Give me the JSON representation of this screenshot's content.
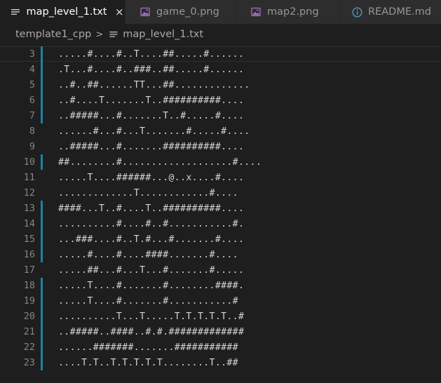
{
  "tabs": [
    {
      "label": "map_level_1.txt",
      "icon": "text-file-icon",
      "active": true,
      "close": "×"
    },
    {
      "label": "game_0.png",
      "icon": "image-file-icon",
      "active": false
    },
    {
      "label": "map2.png",
      "icon": "image-file-icon",
      "active": false
    },
    {
      "label": "README.md",
      "icon": "info-icon",
      "active": false
    }
  ],
  "breadcrumb": {
    "folder": "template1_cpp",
    "separator": ">",
    "file": "map_level_1.txt"
  },
  "editor": {
    "lines": [
      {
        "num": "3",
        "text": ".....#....#..T....##.....#......",
        "modified": true
      },
      {
        "num": "4",
        "text": ".T...#....#..###..##.....#......",
        "modified": true
      },
      {
        "num": "5",
        "text": "..#..##......TT...##.............",
        "modified": true
      },
      {
        "num": "6",
        "text": "..#....T.......T..##########....",
        "modified": true
      },
      {
        "num": "7",
        "text": "..#####...#.......T..#.....#....",
        "modified": true
      },
      {
        "num": "8",
        "text": "......#...#...T.......#.....#....",
        "modified": false
      },
      {
        "num": "9",
        "text": "..#####...#.......##########....",
        "modified": false
      },
      {
        "num": "10",
        "text": "##........#...................#....",
        "modified": true
      },
      {
        "num": "11",
        "text": ".....T....######...@..x....#....",
        "modified": false
      },
      {
        "num": "12",
        "text": ".............T............#....",
        "modified": false
      },
      {
        "num": "13",
        "text": "####...T..#....T..##########....",
        "modified": true
      },
      {
        "num": "14",
        "text": "..........#....#..#...........#.",
        "modified": true
      },
      {
        "num": "15",
        "text": "...###....#..T.#...#.......#....",
        "modified": true
      },
      {
        "num": "16",
        "text": ".....#....#....####.......#....",
        "modified": true
      },
      {
        "num": "17",
        "text": ".....##...#...T...#.......#.....",
        "modified": false
      },
      {
        "num": "18",
        "text": ".....T....#.......#........####.",
        "modified": true
      },
      {
        "num": "19",
        "text": ".....T....#.......#...........#",
        "modified": true
      },
      {
        "num": "20",
        "text": "..........T...T.....T.T.T.T.T..#",
        "modified": true
      },
      {
        "num": "21",
        "text": "..#####..####..#.#.#############",
        "modified": true
      },
      {
        "num": "22",
        "text": "......#######.......###########",
        "modified": true
      },
      {
        "num": "23",
        "text": "....T.T..T.T.T.T.T........T..##",
        "modified": true
      }
    ]
  },
  "colors": {
    "background": "#1e1e1e",
    "tabbar": "#252526",
    "inactive_tab": "#2d2d2d",
    "modified_marker": "#1b81a8",
    "line_number": "#858585",
    "text": "#d4d4d4"
  }
}
